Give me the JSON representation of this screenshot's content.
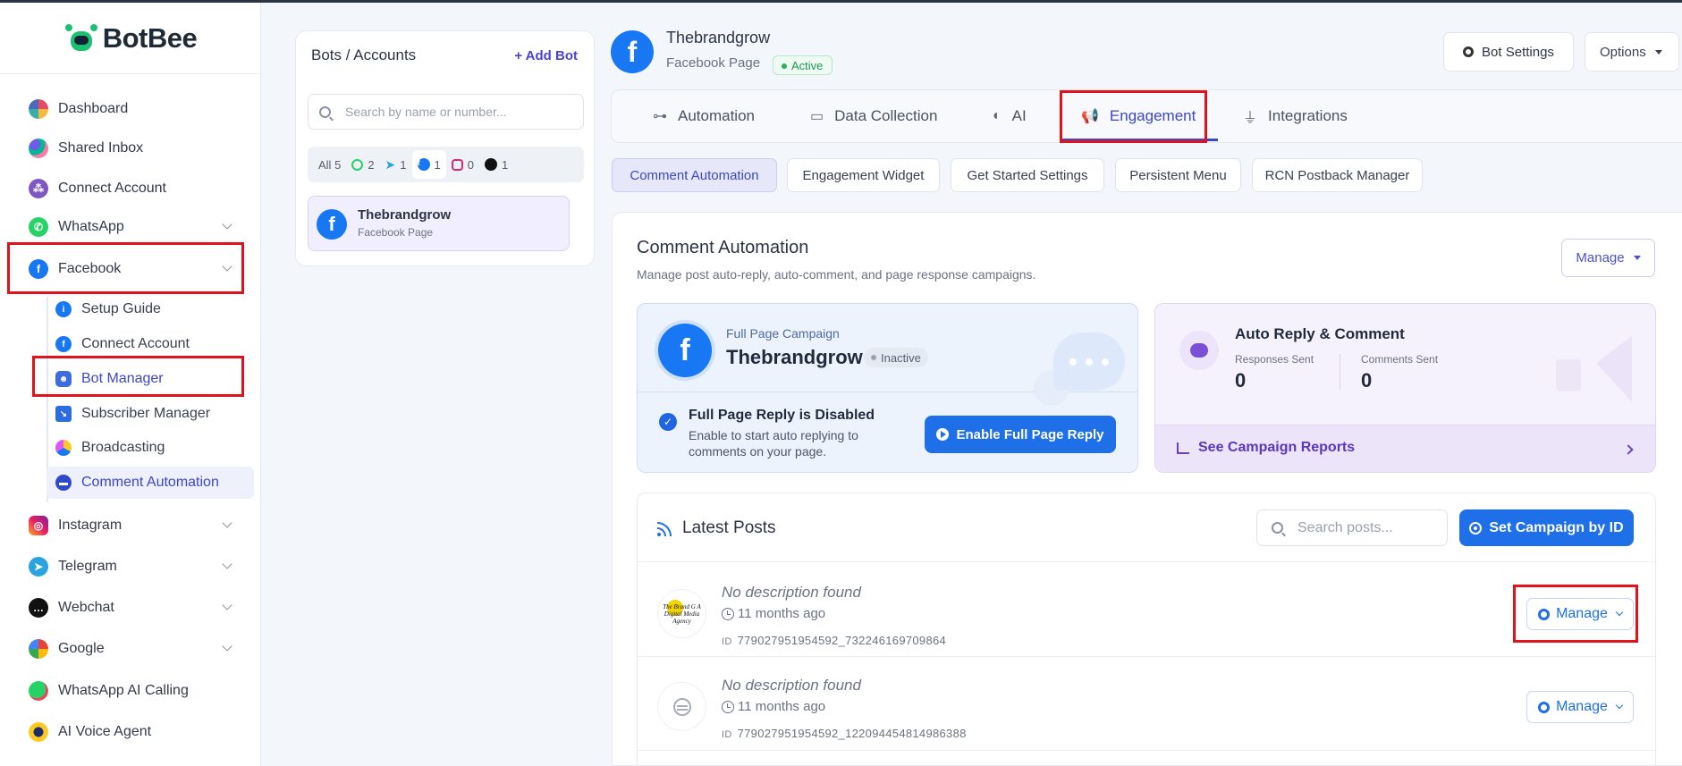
{
  "app": {
    "brand": "BotBee"
  },
  "sidebar": {
    "items": [
      {
        "label": "Dashboard",
        "icon": "dashboard-icon"
      },
      {
        "label": "Shared Inbox",
        "icon": "shared-inbox-icon"
      },
      {
        "label": "Connect Account",
        "icon": "connect-account-icon"
      },
      {
        "label": "WhatsApp",
        "icon": "whatsapp-icon"
      },
      {
        "label": "Facebook",
        "icon": "facebook-icon"
      },
      {
        "label": "Instagram",
        "icon": "instagram-icon"
      },
      {
        "label": "Telegram",
        "icon": "telegram-icon"
      },
      {
        "label": "Webchat",
        "icon": "webchat-icon"
      },
      {
        "label": "Google",
        "icon": "google-icon"
      },
      {
        "label": "WhatsApp AI Calling",
        "icon": "whatsapp-ai-calling-icon"
      },
      {
        "label": "AI Voice Agent",
        "icon": "ai-voice-agent-icon"
      }
    ],
    "facebook_sub": [
      {
        "label": "Setup Guide",
        "icon": "info-icon"
      },
      {
        "label": "Connect Account",
        "icon": "facebook-icon"
      },
      {
        "label": "Bot Manager",
        "icon": "robot-icon"
      },
      {
        "label": "Subscriber Manager",
        "icon": "subscriber-icon"
      },
      {
        "label": "Broadcasting",
        "icon": "broadcast-icon"
      },
      {
        "label": "Comment Automation",
        "icon": "comment-icon"
      }
    ]
  },
  "bots": {
    "title": "Bots / Accounts",
    "add_label": "+ Add Bot",
    "search_placeholder": "Search by name or number...",
    "filters": [
      {
        "label": "All",
        "count": "5"
      },
      {
        "label": "WhatsApp",
        "count": "2"
      },
      {
        "label": "Telegram",
        "count": "1"
      },
      {
        "label": "Facebook",
        "count": "1"
      },
      {
        "label": "Instagram",
        "count": "0"
      },
      {
        "label": "Webchat",
        "count": "1"
      }
    ],
    "card": {
      "name": "Thebrandgrow",
      "type": "Facebook Page"
    }
  },
  "header": {
    "page_name": "Thebrandgrow",
    "page_type": "Facebook Page",
    "status": "Active",
    "settings_label": "Bot Settings",
    "options_label": "Options"
  },
  "tabs": [
    {
      "label": "Automation",
      "icon": "automation-icon"
    },
    {
      "label": "Data Collection",
      "icon": "folder-icon"
    },
    {
      "label": "AI",
      "icon": "ai-icon"
    },
    {
      "label": "Engagement",
      "icon": "megaphone-icon"
    },
    {
      "label": "Integrations",
      "icon": "plug-icon"
    }
  ],
  "subtabs": [
    "Comment Automation",
    "Engagement Widget",
    "Get Started Settings",
    "Persistent Menu",
    "RCN Postback Manager"
  ],
  "comment_automation": {
    "title": "Comment Automation",
    "subtitle": "Manage post auto-reply, auto-comment, and page response campaigns.",
    "manage_label": "Manage"
  },
  "full_page": {
    "label": "Full Page Campaign",
    "name": "Thebrandgrow",
    "status": "Inactive",
    "state_title": "Full Page Reply is Disabled",
    "state_hint": "Enable to start auto replying to comments on your page.",
    "enable_label": "Enable Full Page Reply"
  },
  "auto_reply": {
    "title": "Auto Reply & Comment",
    "responses_label": "Responses Sent",
    "responses_value": "0",
    "comments_label": "Comments Sent",
    "comments_value": "0",
    "reports_label": "See Campaign Reports"
  },
  "latest_posts": {
    "title": "Latest Posts",
    "search_placeholder": "Search posts...",
    "set_campaign_label": "Set Campaign by ID",
    "id_label": "ID",
    "manage_label": "Manage",
    "posts": [
      {
        "description": "No description found",
        "time": "11 months ago",
        "id": "779027951954592_732246169709864",
        "thumb_text": "The Brand G A Digital Media Agency"
      },
      {
        "description": "No description found",
        "time": "11 months ago",
        "id": "779027951954592_122094454814986388"
      }
    ]
  },
  "colors": {
    "accent": "#3d47c4",
    "primary_blue": "#1e6fe8",
    "facebook": "#1877f2",
    "highlight_box": "#e0121c"
  }
}
